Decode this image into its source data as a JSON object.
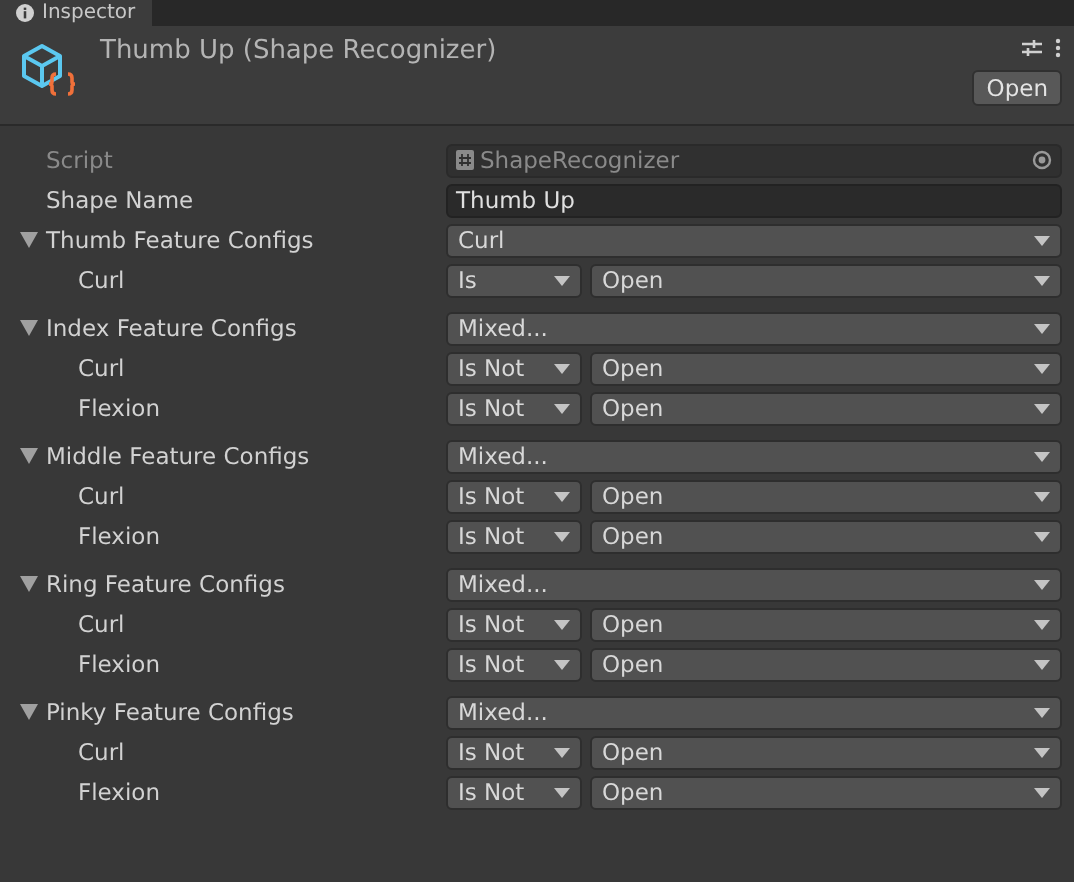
{
  "tab": {
    "label": "Inspector"
  },
  "header": {
    "title": "Thumb Up (Shape Recognizer)",
    "button": "Open"
  },
  "script": {
    "label": "Script",
    "value": "ShapeRecognizer"
  },
  "shape_name": {
    "label": "Shape Name",
    "value": "Thumb Up"
  },
  "groups": [
    {
      "label": "Thumb Feature Configs",
      "expanded": true,
      "value": "Curl",
      "children": [
        {
          "label": "Curl",
          "operator": "Is",
          "state": "Open"
        }
      ]
    },
    {
      "label": "Index Feature Configs",
      "expanded": true,
      "value": "Mixed...",
      "children": [
        {
          "label": "Curl",
          "operator": "Is Not",
          "state": "Open"
        },
        {
          "label": "Flexion",
          "operator": "Is Not",
          "state": "Open"
        }
      ]
    },
    {
      "label": "Middle Feature Configs",
      "expanded": true,
      "value": "Mixed...",
      "children": [
        {
          "label": "Curl",
          "operator": "Is Not",
          "state": "Open"
        },
        {
          "label": "Flexion",
          "operator": "Is Not",
          "state": "Open"
        }
      ]
    },
    {
      "label": "Ring Feature Configs",
      "expanded": true,
      "value": "Mixed...",
      "children": [
        {
          "label": "Curl",
          "operator": "Is Not",
          "state": "Open"
        },
        {
          "label": "Flexion",
          "operator": "Is Not",
          "state": "Open"
        }
      ]
    },
    {
      "label": "Pinky Feature Configs",
      "expanded": true,
      "value": "Mixed...",
      "children": [
        {
          "label": "Curl",
          "operator": "Is Not",
          "state": "Open"
        },
        {
          "label": "Flexion",
          "operator": "Is Not",
          "state": "Open"
        }
      ]
    }
  ]
}
